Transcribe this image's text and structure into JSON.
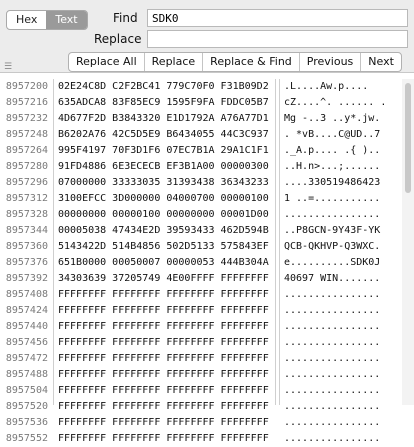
{
  "toolbar": {
    "mode_hex": "Hex",
    "mode_text": "Text",
    "find_label": "Find",
    "find_value": "SDK0",
    "replace_label": "Replace",
    "replace_value": "",
    "buttons": [
      "Replace All",
      "Replace",
      "Replace & Find",
      "Previous",
      "Next"
    ]
  },
  "rows": [
    {
      "offset": "8957200",
      "hex": "02E24C8D C2F2BC41 779C70F0 F31B09D2",
      "text": ".L....Aw.p...."
    },
    {
      "offset": "8957216",
      "hex": "635ADCA8 83F85EC9 1595F9FA FDDC05B7",
      "text": "cZ....^. ...... ."
    },
    {
      "offset": "8957232",
      "hex": "4D677F2D B3843320 E1D1792A A76A77D1",
      "text": "Mg -..3 ..y*.jw."
    },
    {
      "offset": "8957248",
      "hex": "B6202A76 42C5D5E9 B6434055 44C3C937",
      "text": ". *vB....C@UD..7"
    },
    {
      "offset": "8957264",
      "hex": "995F4197 70F3D1F6 07EC7B1A 29A1C1F1",
      "text": "._A.p.... .{ ).."
    },
    {
      "offset": "8957280",
      "hex": "91FD4886 6E3ECECB EF3B1A00 00000300",
      "text": "..H.n>...;......"
    },
    {
      "offset": "8957296",
      "hex": "07000000 33333035 31393438 36343233",
      "text": "....330519486423"
    },
    {
      "offset": "8957312",
      "hex": "3100EFCC 3D000000 04000700 00000100",
      "text": "1 ..=..........."
    },
    {
      "offset": "8957328",
      "hex": "00000000 00000100 00000000 00001D00",
      "text": "................"
    },
    {
      "offset": "8957344",
      "hex": "00005038 47434E2D 39593433 462D594B",
      "text": "..P8GCN-9Y43F-YK"
    },
    {
      "offset": "8957360",
      "hex": "5143422D 514B4856 502D5133 575843EF",
      "text": "QCB-QKHVP-Q3WXC."
    },
    {
      "offset": "8957376",
      "hex": "651B0000 00050007 00000053 444B304A",
      "text": "e..........SDK0J"
    },
    {
      "offset": "8957392",
      "hex": "34303639 37205749 4E00FFFF FFFFFFFF",
      "text": "40697 WIN......."
    },
    {
      "offset": "8957408",
      "hex": "FFFFFFFF FFFFFFFF FFFFFFFF FFFFFFFF",
      "text": "................"
    },
    {
      "offset": "8957424",
      "hex": "FFFFFFFF FFFFFFFF FFFFFFFF FFFFFFFF",
      "text": "................"
    },
    {
      "offset": "8957440",
      "hex": "FFFFFFFF FFFFFFFF FFFFFFFF FFFFFFFF",
      "text": "................"
    },
    {
      "offset": "8957456",
      "hex": "FFFFFFFF FFFFFFFF FFFFFFFF FFFFFFFF",
      "text": "................"
    },
    {
      "offset": "8957472",
      "hex": "FFFFFFFF FFFFFFFF FFFFFFFF FFFFFFFF",
      "text": "................"
    },
    {
      "offset": "8957488",
      "hex": "FFFFFFFF FFFFFFFF FFFFFFFF FFFFFFFF",
      "text": "................"
    },
    {
      "offset": "8957504",
      "hex": "FFFFFFFF FFFFFFFF FFFFFFFF FFFFFFFF",
      "text": "................"
    },
    {
      "offset": "8957520",
      "hex": "FFFFFFFF FFFFFFFF FFFFFFFF FFFFFFFF",
      "text": "................"
    },
    {
      "offset": "8957536",
      "hex": "FFFFFFFF FFFFFFFF FFFFFFFF FFFFFFFF",
      "text": "................"
    },
    {
      "offset": "8957552",
      "hex": "FFFFFFFF FFFFFFFF FFFFFFFF FFFFFFFF",
      "text": "................"
    }
  ]
}
